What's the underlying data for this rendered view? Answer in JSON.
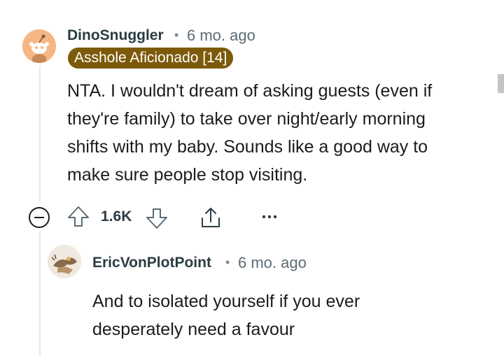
{
  "comments": [
    {
      "username": "DinoSnuggler",
      "separator": "•",
      "timestamp": "6 mo. ago",
      "flair": "Asshole Aficionado [14]",
      "body_lines": [
        "NTA. I wouldn't dream of asking guests (even if",
        "they're family) to take over night/early morning",
        "shifts with my baby. Sounds like a good way to",
        "make sure people stop visiting."
      ],
      "score": "1.6K",
      "avatar_color": "#f5b683"
    },
    {
      "username": "EricVonPlotPoint",
      "separator": "•",
      "timestamp": "6 mo. ago",
      "body_lines": [
        "And to isolated yourself if you ever",
        "desperately need a favour"
      ]
    }
  ],
  "icons": {
    "collapse": "collapse-icon",
    "upvote": "upvote-arrow-icon",
    "downvote": "downvote-arrow-icon",
    "share": "share-icon",
    "more": "more-options-icon"
  },
  "colors": {
    "flair_bg": "#7c5a0a",
    "username": "#2a3c42",
    "meta": "#5c6c74"
  }
}
